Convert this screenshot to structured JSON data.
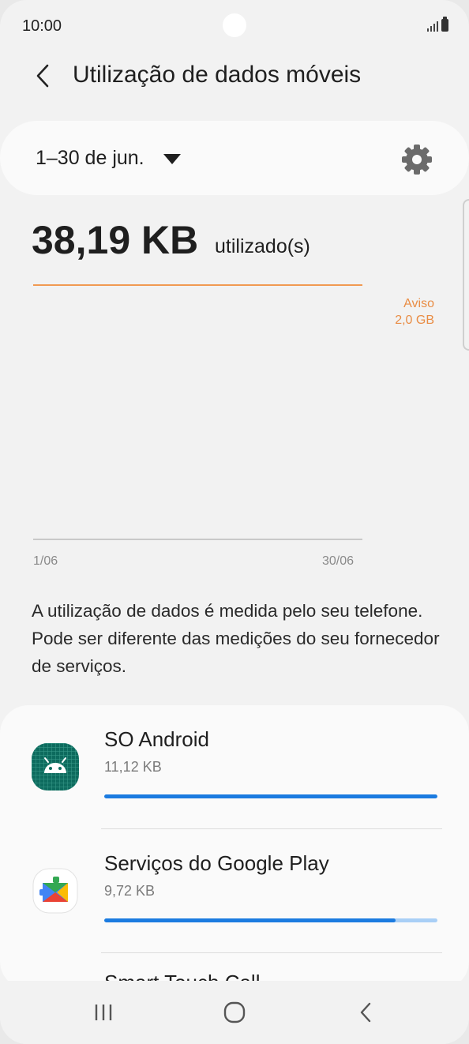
{
  "status_bar": {
    "time": "10:00"
  },
  "header": {
    "title": "Utilização de dados móveis"
  },
  "period": {
    "label": "1–30 de jun."
  },
  "usage": {
    "amount": "38,19 KB",
    "suffix": "utilizado(s)"
  },
  "chart": {
    "warning_label": "Aviso",
    "warning_value": "2,0 GB",
    "x_start": "1/06",
    "x_end": "30/06"
  },
  "info_text": "A utilização de dados é medida pelo seu telefone. Pode ser diferente das medições do seu fornecedor de serviços.",
  "apps": [
    {
      "name": "SO Android",
      "size": "11,12 KB",
      "usage_fraction": 1.0,
      "icon": "android-icon"
    },
    {
      "name": "Serviços do Google Play",
      "size": "9,72 KB",
      "usage_fraction": 0.874,
      "icon": "google-play-services-icon"
    },
    {
      "name": "Smart Touch Call",
      "icon": "app-icon"
    }
  ],
  "colors": {
    "accent": "#1b7be0",
    "warning": "#e98d45"
  }
}
